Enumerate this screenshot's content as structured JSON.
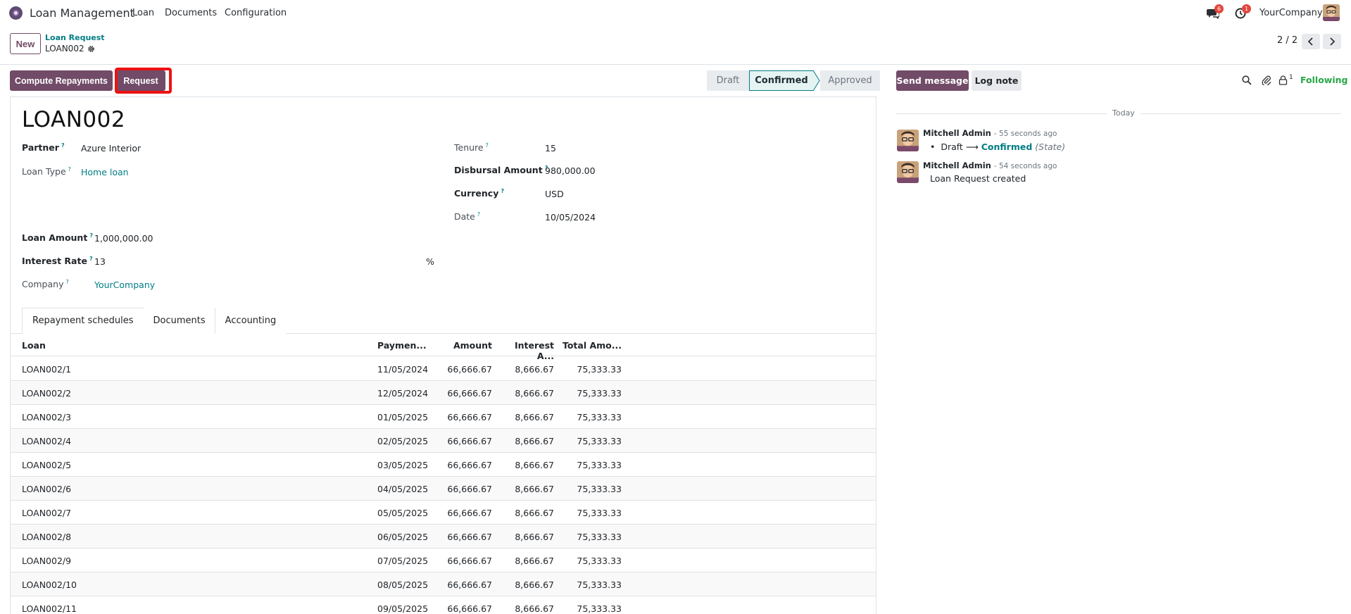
{
  "navbar": {
    "app_name": "Loan Management",
    "menus": [
      "Loan",
      "Documents",
      "Configuration"
    ],
    "messages_badge": "6",
    "activities_badge": "1",
    "company": "YourCompany"
  },
  "control_panel": {
    "new_label": "New",
    "breadcrumb_parent": "Loan Request",
    "breadcrumb_current": "LOAN002",
    "pager": "2 / 2"
  },
  "actions": {
    "compute_repayments": "Compute Repayments",
    "request": "Request"
  },
  "statusbar": {
    "steps": [
      "Draft",
      "Confirmed",
      "Approved"
    ],
    "active": "Confirmed"
  },
  "chatter_buttons": {
    "send_message": "Send message",
    "log_note": "Log note",
    "followers_count": "1",
    "following": "Following"
  },
  "form": {
    "title": "LOAN002",
    "partner_label": "Partner",
    "partner": "Azure Interior",
    "loan_type_label": "Loan Type",
    "loan_type": "Home loan",
    "loan_amount_label": "Loan Amount",
    "loan_amount": "1,000,000.00",
    "interest_rate_label": "Interest Rate",
    "interest_rate": "13",
    "interest_unit": "%",
    "company_label": "Company",
    "company": "YourCompany",
    "tenure_label": "Tenure",
    "tenure": "15",
    "disbursal_label": "Disbursal Amount",
    "disbursal": "980,000.00",
    "currency_label": "Currency",
    "currency": "USD",
    "date_label": "Date",
    "date": "10/05/2024",
    "help_mark": "?"
  },
  "tabs": [
    "Repayment schedules",
    "Documents",
    "Accounting"
  ],
  "table": {
    "headers": [
      "Loan",
      "Paymen...",
      "Amount",
      "Interest A...",
      "Total Amo..."
    ],
    "rows": [
      [
        "LOAN002/1",
        "11/05/2024",
        "66,666.67",
        "8,666.67",
        "75,333.33"
      ],
      [
        "LOAN002/2",
        "12/05/2024",
        "66,666.67",
        "8,666.67",
        "75,333.33"
      ],
      [
        "LOAN002/3",
        "01/05/2025",
        "66,666.67",
        "8,666.67",
        "75,333.33"
      ],
      [
        "LOAN002/4",
        "02/05/2025",
        "66,666.67",
        "8,666.67",
        "75,333.33"
      ],
      [
        "LOAN002/5",
        "03/05/2025",
        "66,666.67",
        "8,666.67",
        "75,333.33"
      ],
      [
        "LOAN002/6",
        "04/05/2025",
        "66,666.67",
        "8,666.67",
        "75,333.33"
      ],
      [
        "LOAN002/7",
        "05/05/2025",
        "66,666.67",
        "8,666.67",
        "75,333.33"
      ],
      [
        "LOAN002/8",
        "06/05/2025",
        "66,666.67",
        "8,666.67",
        "75,333.33"
      ],
      [
        "LOAN002/9",
        "07/05/2025",
        "66,666.67",
        "8,666.67",
        "75,333.33"
      ],
      [
        "LOAN002/10",
        "08/05/2025",
        "66,666.67",
        "8,666.67",
        "75,333.33"
      ],
      [
        "LOAN002/11",
        "09/05/2025",
        "66,666.67",
        "8,666.67",
        "75,333.33"
      ]
    ]
  },
  "chatter": {
    "today": "Today",
    "messages": [
      {
        "author": "Mitchell Admin",
        "time": "- 55 seconds ago",
        "track_old": "Draft",
        "track_arrow": "⟶",
        "track_new": "Confirmed",
        "track_field": "(State)"
      },
      {
        "author": "Mitchell Admin",
        "time": "- 54 seconds ago",
        "body": "Loan Request created"
      }
    ]
  },
  "colors": {
    "brand": "#714b67",
    "link": "#017e84",
    "badge": "#e3473d",
    "following": "#28a745",
    "highlight": "#ee1111"
  }
}
